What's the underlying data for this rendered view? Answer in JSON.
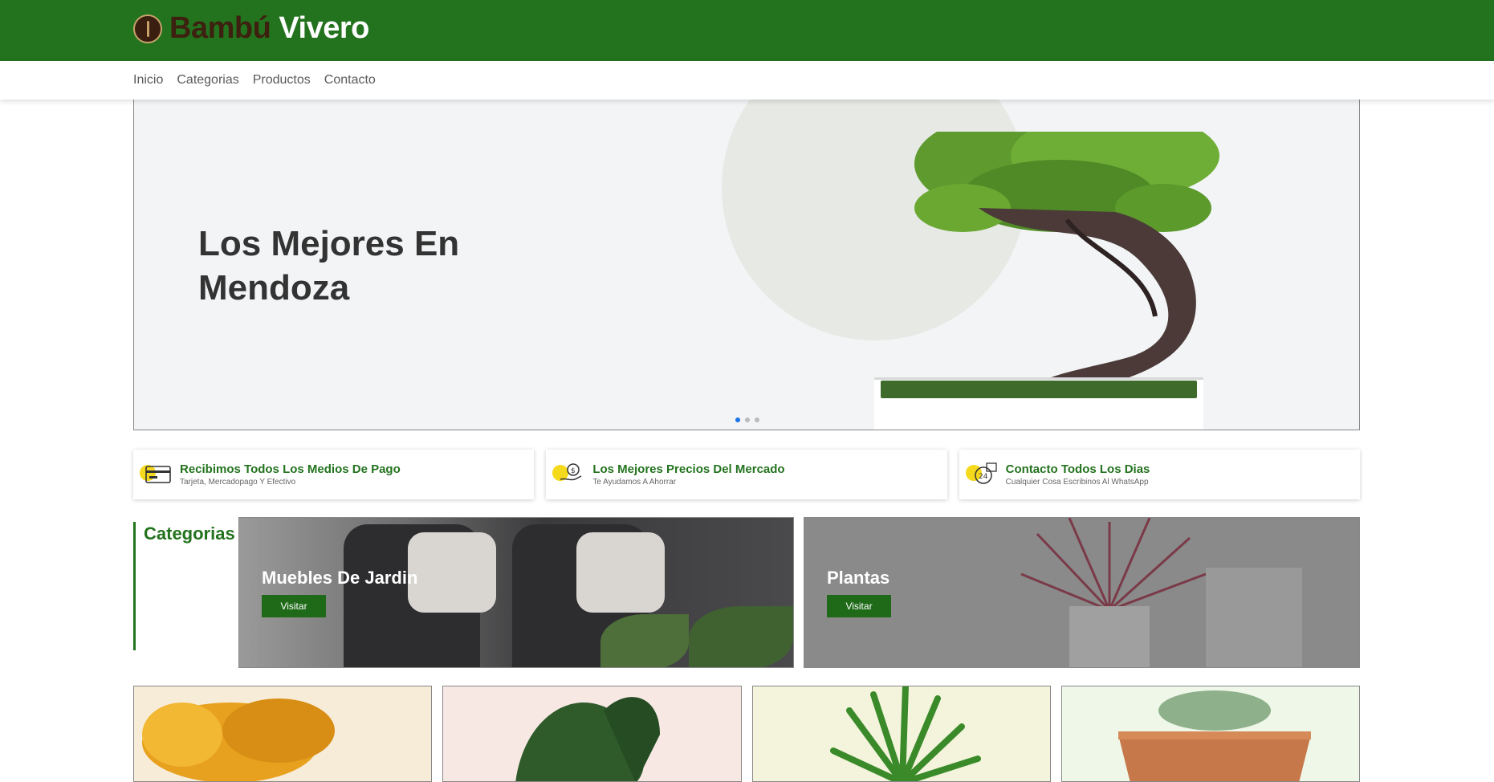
{
  "header": {
    "brand_part1": "Bambú",
    "brand_part2": "Vivero",
    "brand_color": "#23731e"
  },
  "nav": {
    "items": [
      {
        "label": "Inicio"
      },
      {
        "label": "Categorias"
      },
      {
        "label": "Productos"
      },
      {
        "label": "Contacto"
      }
    ]
  },
  "hero": {
    "title": "Los Mejores En Mendoza",
    "slides": 3,
    "active_slide": 1
  },
  "features": [
    {
      "icon": "credit-card-icon",
      "title": "Recibimos Todos Los Medios De Pago",
      "subtitle": "Tarjeta, Mercadopago Y Efectivo"
    },
    {
      "icon": "money-hand-icon",
      "title": "Los Mejores Precios Del Mercado",
      "subtitle": "Te Ayudamos A Ahorrar"
    },
    {
      "icon": "24h-support-icon",
      "title": "Contacto Todos Los Dias",
      "subtitle": "Cualquier Cosa Escribinos Al WhatsApp"
    }
  ],
  "categories": {
    "heading": "Categorias",
    "items": [
      {
        "title": "Muebles De Jardin",
        "button": "Visitar"
      },
      {
        "title": "Plantas",
        "button": "Visitar"
      }
    ]
  },
  "products": [
    {
      "image": "bonsai-orange"
    },
    {
      "image": "monstera"
    },
    {
      "image": "dracaena"
    },
    {
      "image": "succulent"
    }
  ]
}
